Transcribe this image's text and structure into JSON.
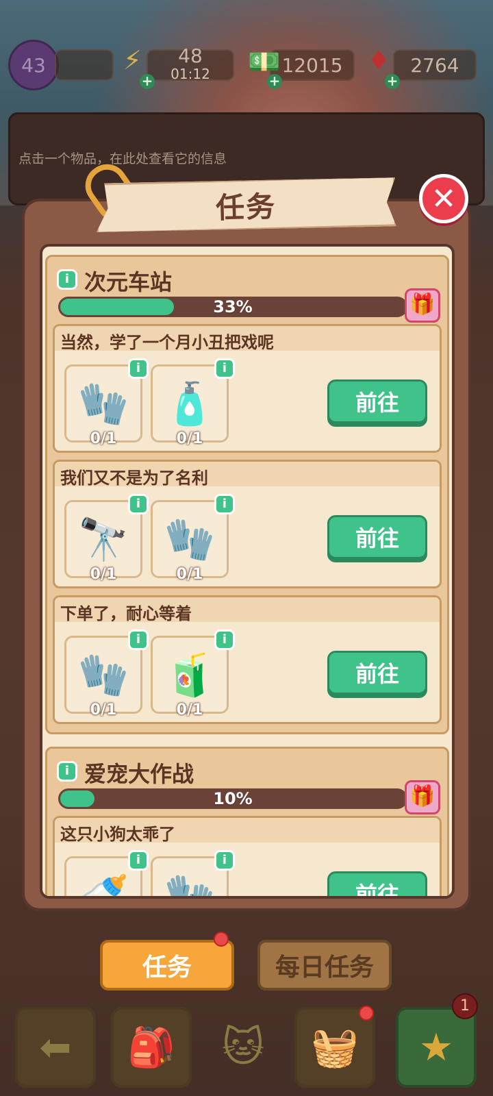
{
  "header": {
    "level": "43",
    "energy": "48",
    "energy_timer": "01:12",
    "cash": "12015",
    "gems": "2764",
    "info_hint": "点击一个物品，在此处查看它的信息"
  },
  "panel": {
    "title": "任务",
    "close_label": "✕"
  },
  "sections": [
    {
      "name": "次元车站",
      "progress_label": "33%",
      "progress": 0.33,
      "tasks": [
        {
          "title": "当然，学了一个月小丑把戏呢",
          "button": "前往",
          "items": [
            {
              "icon": "red-glove-icon",
              "glyph": "🧤",
              "count": "0/1"
            },
            {
              "icon": "lotion-bottle-icon",
              "glyph": "🧴",
              "count": "0/1"
            }
          ]
        },
        {
          "title": "我们又不是为了名利",
          "button": "前往",
          "items": [
            {
              "icon": "binoculars-icon",
              "glyph": "🔭",
              "count": "0/1"
            },
            {
              "icon": "red-glove-icon",
              "glyph": "🧤",
              "count": "0/1"
            }
          ]
        },
        {
          "title": "下单了，耐心等着",
          "button": "前往",
          "items": [
            {
              "icon": "red-glove-icon",
              "glyph": "🧤",
              "count": "0/1"
            },
            {
              "icon": "juice-bottle-icon",
              "glyph": "🧃",
              "count": "0/1"
            }
          ]
        }
      ]
    },
    {
      "name": "爱宠大作战",
      "progress_label": "10%",
      "progress": 0.1,
      "tasks": [
        {
          "title": "这只小狗太乖了",
          "button": "前往",
          "items": [
            {
              "icon": "bottle-icon",
              "glyph": "🍼",
              "count": ""
            },
            {
              "icon": "red-glove-icon",
              "glyph": "🧤",
              "count": ""
            }
          ]
        }
      ]
    }
  ],
  "tabs": {
    "tasks": "任务",
    "daily": "每日任务"
  },
  "bottom_nav": {
    "badge_count": "1"
  },
  "colors": {
    "accent_green": "#3fc38a",
    "tab_orange": "#f6a63a",
    "close_red": "#ec3d4d"
  }
}
